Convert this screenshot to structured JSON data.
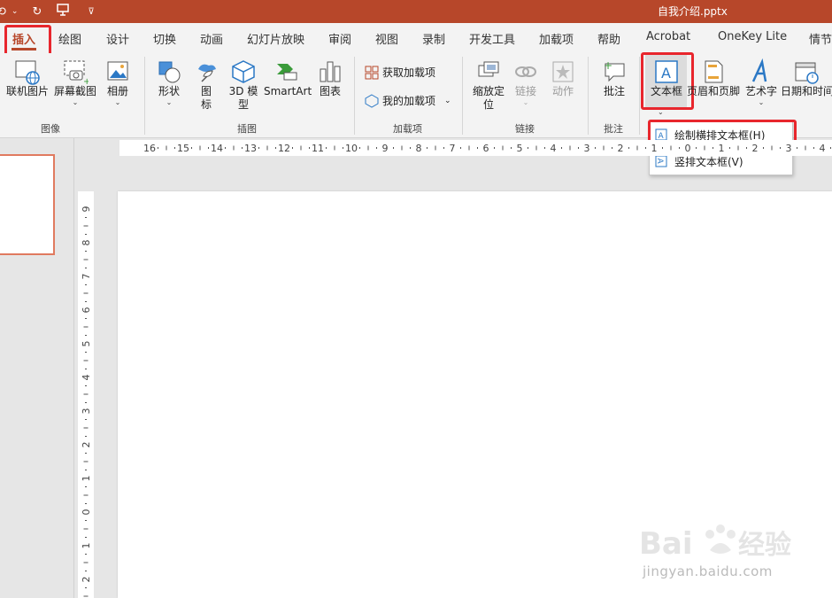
{
  "window": {
    "filename": "自我介绍.pptx"
  },
  "qat": {
    "items": [
      "⟲",
      "⌄",
      "↻",
      "🖫",
      "⊽"
    ]
  },
  "tabs": [
    {
      "label": "插入",
      "active": true
    },
    {
      "label": "绘图"
    },
    {
      "label": "设计"
    },
    {
      "label": "切换"
    },
    {
      "label": "动画"
    },
    {
      "label": "幻灯片放映"
    },
    {
      "label": "审阅"
    },
    {
      "label": "视图"
    },
    {
      "label": "录制"
    },
    {
      "label": "开发工具"
    },
    {
      "label": "加载项"
    },
    {
      "label": "帮助"
    },
    {
      "label": "Acrobat"
    },
    {
      "label": "OneKey Lite"
    },
    {
      "label": "情节"
    }
  ],
  "ribbon": {
    "images": {
      "online_pictures": "联机图片",
      "screenshot": "屏幕截图",
      "album": "相册",
      "group": "图像"
    },
    "illustrations": {
      "shapes": "形状",
      "icons": "图标",
      "model3d": "3D 模型",
      "smartart": "SmartArt",
      "chart": "图表",
      "group": "插图"
    },
    "addins": {
      "get": "获取加载项",
      "mine": "我的加载项",
      "group": "加载项"
    },
    "links": {
      "zoom": "缩放定位",
      "link": "链接",
      "action": "动作",
      "group": "链接"
    },
    "comments": {
      "comment": "批注",
      "group": "批注"
    },
    "text": {
      "textbox": "文本框",
      "header_footer": "页眉和页脚",
      "wordart": "艺术字",
      "datetime": "日期和时间"
    }
  },
  "textbox_menu": {
    "items": [
      {
        "label": "绘制横排文本框(H)"
      },
      {
        "label": "竖排文本框(V)"
      }
    ]
  },
  "ruler": {
    "h_labels": [
      "16",
      "15",
      "14",
      "13",
      "12",
      "11",
      "10",
      "9",
      "8",
      "7",
      "6",
      "5",
      "4",
      "3",
      "2",
      "1",
      "0",
      "1",
      "2",
      "3",
      "4"
    ],
    "v_labels": [
      "9",
      "8",
      "7",
      "6",
      "5",
      "4",
      "3",
      "2",
      "1",
      "0",
      "1",
      "2"
    ]
  },
  "watermark": {
    "text": "jingyan.baidu.com",
    "brand": "Bai du 经验"
  },
  "colors": {
    "accent": "#b7472a",
    "highlight": "#e8262d"
  }
}
